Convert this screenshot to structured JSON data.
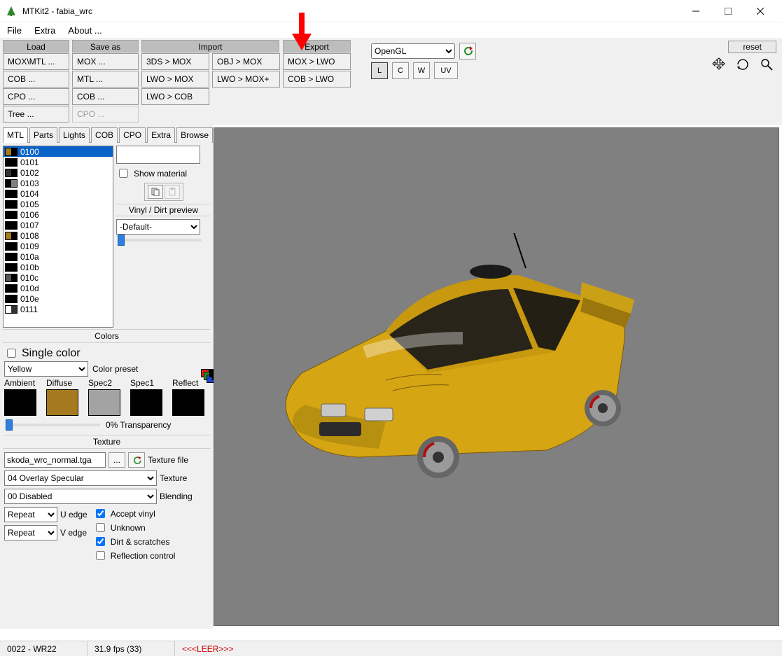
{
  "window": {
    "title": "MTKit2 - fabia_wrc"
  },
  "menu": {
    "file": "File",
    "extra": "Extra",
    "about": "About ..."
  },
  "toolbar": {
    "headers": {
      "load": "Load",
      "saveas": "Save as",
      "import": "Import",
      "export": "Export"
    },
    "load": [
      "MOX\\MTL ...",
      "COB ...",
      "CPO ...",
      "Tree ..."
    ],
    "saveas": [
      "MOX ...",
      "MTL ...",
      "COB ...",
      "CPO ..."
    ],
    "import_a": [
      "3DS > MOX",
      "LWO > MOX",
      "LWO > COB"
    ],
    "import_b": [
      "OBJ > MOX",
      "LWO > MOX+"
    ],
    "export": [
      "MOX > LWO",
      "COB > LWO"
    ],
    "render_mode": "OpenGL",
    "letters": {
      "l": "L",
      "c": "C",
      "w": "W",
      "uv": "UV"
    },
    "reset": "reset"
  },
  "tabs": [
    "MTL",
    "Parts",
    "Lights",
    "COB",
    "CPO",
    "Extra",
    "Browse"
  ],
  "materials": {
    "items": [
      {
        "id": "0100",
        "c1": "#a47a1e",
        "c2": "#000000",
        "sel": true
      },
      {
        "id": "0101",
        "c1": "#000000",
        "c2": "#000000"
      },
      {
        "id": "0102",
        "c1": "#333333",
        "c2": "#000000"
      },
      {
        "id": "0103",
        "c1": "#000000",
        "c2": "#808080"
      },
      {
        "id": "0104",
        "c1": "#000000",
        "c2": "#000000"
      },
      {
        "id": "0105",
        "c1": "#000000",
        "c2": "#000000"
      },
      {
        "id": "0106",
        "c1": "#000000",
        "c2": "#000000"
      },
      {
        "id": "0107",
        "c1": "#000000",
        "c2": "#000000"
      },
      {
        "id": "0108",
        "c1": "#a47a1e",
        "c2": "#000000"
      },
      {
        "id": "0109",
        "c1": "#000000",
        "c2": "#000000"
      },
      {
        "id": "010a",
        "c1": "#000000",
        "c2": "#000000"
      },
      {
        "id": "010b",
        "c1": "#000000",
        "c2": "#000000"
      },
      {
        "id": "010c",
        "c1": "#555555",
        "c2": "#000000"
      },
      {
        "id": "010d",
        "c1": "#000000",
        "c2": "#000000"
      },
      {
        "id": "010e",
        "c1": "#000000",
        "c2": "#000000"
      },
      {
        "id": "0111",
        "c1": "#ffffff",
        "c2": "#333333"
      }
    ],
    "show_material": "Show material",
    "vinyl_header": "Vinyl / Dirt preview",
    "vinyl_preset": "-Default-"
  },
  "colors": {
    "header": "Colors",
    "single": "Single color",
    "preset_value": "Yellow",
    "preset_label": "Color preset",
    "labels": {
      "ambient": "Ambient",
      "diffuse": "Diffuse",
      "spec2": "Spec2",
      "spec1": "Spec1",
      "reflect": "Reflect"
    },
    "swatches": {
      "ambient": "#000000",
      "diffuse": "#a57a1e",
      "spec2": "#a3a3a3",
      "spec1": "#000000",
      "reflect": "#000000"
    },
    "transparency": "0% Transparency"
  },
  "texture": {
    "header": "Texture",
    "file": "skoda_wrc_normal.tga",
    "file_label": "Texture file",
    "texture_mode": "04 Overlay Specular",
    "texture_label": "Texture",
    "blending_mode": "00 Disabled",
    "blending_label": "Blending",
    "uedge": "Repeat",
    "uedge_label": "U edge",
    "vedge": "Repeat",
    "vedge_label": "V edge",
    "chk_vinyl": "Accept vinyl",
    "chk_unknown": "Unknown",
    "chk_dirt": "Dirt & scratches",
    "chk_refl": "Reflection control"
  },
  "status": {
    "left": "0022 - WR22",
    "fps": "31.9 fps (33)",
    "leer": "<<<LEER>>>"
  }
}
